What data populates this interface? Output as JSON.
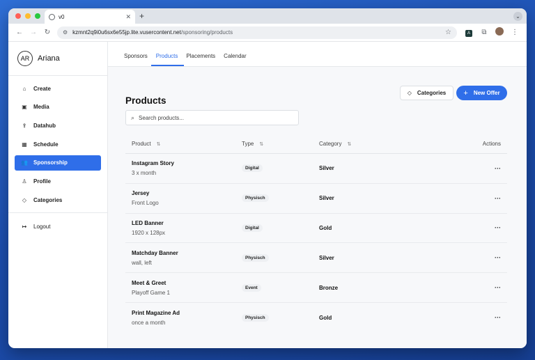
{
  "browser": {
    "tab_title": "v0",
    "url_host": "kzmnt2q9i0u6sx6e55jp.lite.vusercontent.net",
    "url_path": "/sponsoring/products",
    "ext_label": "A"
  },
  "user": {
    "initials": "AR",
    "name": "Ariana"
  },
  "sidebar": {
    "items": [
      {
        "label": "Create",
        "icon": "home-icon"
      },
      {
        "label": "Media",
        "icon": "image-icon"
      },
      {
        "label": "Datahub",
        "icon": "upload-icon"
      },
      {
        "label": "Schedule",
        "icon": "calendar-icon"
      },
      {
        "label": "Sponsorship",
        "icon": "users-icon",
        "active": true
      },
      {
        "label": "Profile",
        "icon": "user-icon"
      },
      {
        "label": "Categories",
        "icon": "tag-icon"
      }
    ],
    "logout_label": "Logout"
  },
  "topnav": {
    "tabs": [
      "Sponsors",
      "Products",
      "Placements",
      "Calendar"
    ],
    "active": "Products"
  },
  "page": {
    "title": "Products",
    "categories_button": "Categories",
    "new_offer_button": "New Offer",
    "search_placeholder": "Search products..."
  },
  "table": {
    "headers": [
      "Product",
      "Type",
      "Category",
      "Actions"
    ],
    "rows": [
      {
        "name": "Instagram Story",
        "desc": "3 x month",
        "type": "Digital",
        "category": "Silver"
      },
      {
        "name": "Jersey",
        "desc": "Front Logo",
        "type": "Physisch",
        "category": "Silver"
      },
      {
        "name": "LED Banner",
        "desc": "1920 x 128px",
        "type": "Digital",
        "category": "Gold"
      },
      {
        "name": "Matchday Banner",
        "desc": "wall, left",
        "type": "Physisch",
        "category": "Silver"
      },
      {
        "name": "Meet & Greet",
        "desc": "Playoff Game 1",
        "type": "Event",
        "category": "Bronze"
      },
      {
        "name": "Print Magazine Ad",
        "desc": "once a month",
        "type": "Physisch",
        "category": "Gold"
      }
    ],
    "actions_glyph": "···"
  },
  "colors": {
    "accent": "#2f6ee9",
    "background": "#f7f8fa"
  }
}
